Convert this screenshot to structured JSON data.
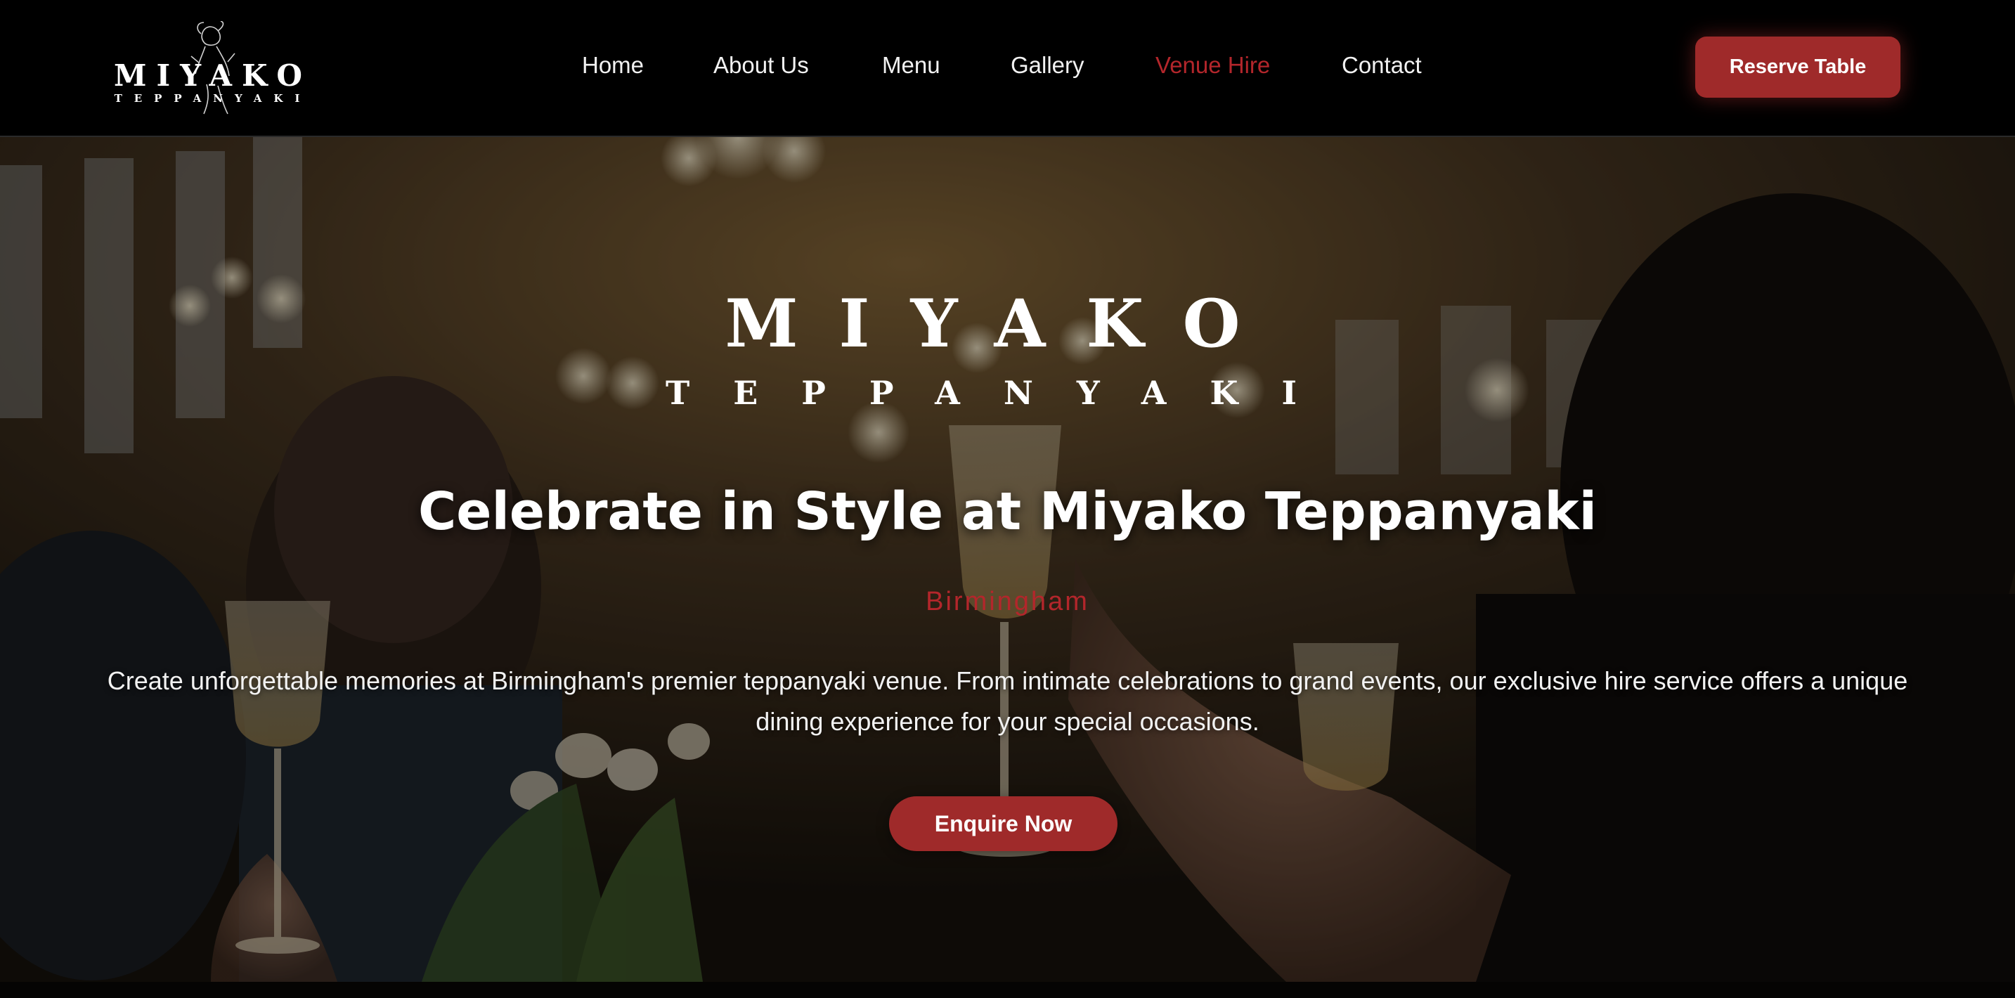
{
  "brand": {
    "name": "MIYAKO",
    "subtitle": "TEPPANYAKI",
    "accent_color": "#9f2a2a",
    "active_link_color": "#b3262b"
  },
  "nav": {
    "links": [
      {
        "label": "Home",
        "active": false
      },
      {
        "label": "About Us",
        "active": false
      },
      {
        "label": "Menu",
        "active": false
      },
      {
        "label": "Gallery",
        "active": false
      },
      {
        "label": "Venue Hire",
        "active": true
      },
      {
        "label": "Contact",
        "active": false
      }
    ],
    "reserve_label": "Reserve Table"
  },
  "hero": {
    "logo_name": "MIYAKO",
    "logo_subtitle": "TEPPANYAKI",
    "title": "Celebrate in Style at Miyako Teppanyaki",
    "location": "Birmingham",
    "description": "Create unforgettable memories at Birmingham's premier teppanyaki venue. From intimate celebrations to grand events, our exclusive hire service offers a unique dining experience for your special occasions.",
    "cta_label": "Enquire Now",
    "background": "celebration-toast-photo"
  }
}
